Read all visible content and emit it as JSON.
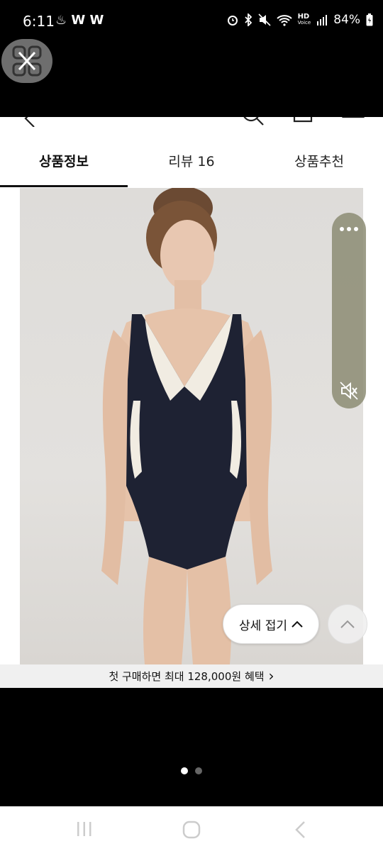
{
  "status_bar": {
    "time": "6:11",
    "left_icons": "W W",
    "hd_label": "HD",
    "voice_label": "Voice",
    "battery": "84%"
  },
  "tabs": [
    {
      "label": "상품정보",
      "active": true
    },
    {
      "label": "리뷰 16",
      "active": false
    },
    {
      "label": "상품추천",
      "active": false
    }
  ],
  "media": {
    "image_alt": "Model wearing navy and white one-piece swimsuit",
    "slide_index": 1,
    "slide_count": 2
  },
  "detail_toggle": {
    "label": "상세 접기"
  },
  "promo": {
    "text": "첫 구매하면 최대 128,000원 혜택",
    "arrow": "›"
  },
  "colors": {
    "accent": "#111111",
    "panel": "#8c8c73",
    "background": "#000000"
  }
}
